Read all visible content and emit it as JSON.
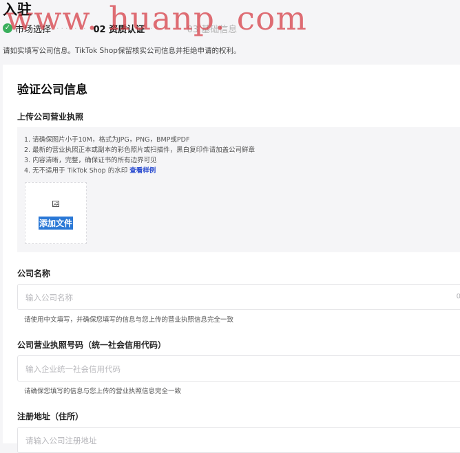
{
  "page": {
    "title": "入驻",
    "notice": "请如实填写公司信息。TikTok Shop保留核实公司信息并拒绝申请的权利。"
  },
  "steps": [
    {
      "label": "市场选择",
      "status": "done",
      "check": "✓"
    },
    {
      "label": "02 资质认证",
      "status": "active"
    },
    {
      "label": "03 基础信息",
      "status": "next"
    }
  ],
  "step_separator": "·······",
  "watermark": "www. huanp. com",
  "card": {
    "title": "验证公司信息",
    "license_section": {
      "label": "上传公司营业执照",
      "requirements": [
        "1. 请确保图片小于10M，格式为JPG，PNG，BMP或PDF",
        "2. 最新的营业执照正本或副本的彩色照片或扫描件，黑白复印件请加盖公司鲜章",
        "3. 内容清晰，完整，确保证书的所有边界可见",
        "4. 无不适用于 TikTok Shop 的水印 "
      ],
      "example_link": "查看样例",
      "add_file_label": "添加文件",
      "add_file_icon": "image-icon"
    },
    "company_name": {
      "label": "公司名称",
      "placeholder": "输入公司名称",
      "counter": "0",
      "hint": "请使用中文填写，并确保您填写的信息与您上传的营业执照信息完全一致"
    },
    "license_number": {
      "label": "公司营业执照号码（统一社会信用代码）",
      "placeholder": "输入企业统一社会信用代码",
      "hint": "请确保您填写的信息与您上传的营业执照信息完全一致"
    },
    "address": {
      "label": "注册地址（住所）",
      "placeholder": "请输入公司注册地址"
    }
  },
  "colors": {
    "accent": "#2a78d6",
    "link": "#2d4ed0",
    "success": "#3aaf5c",
    "watermark": "#d63840"
  }
}
